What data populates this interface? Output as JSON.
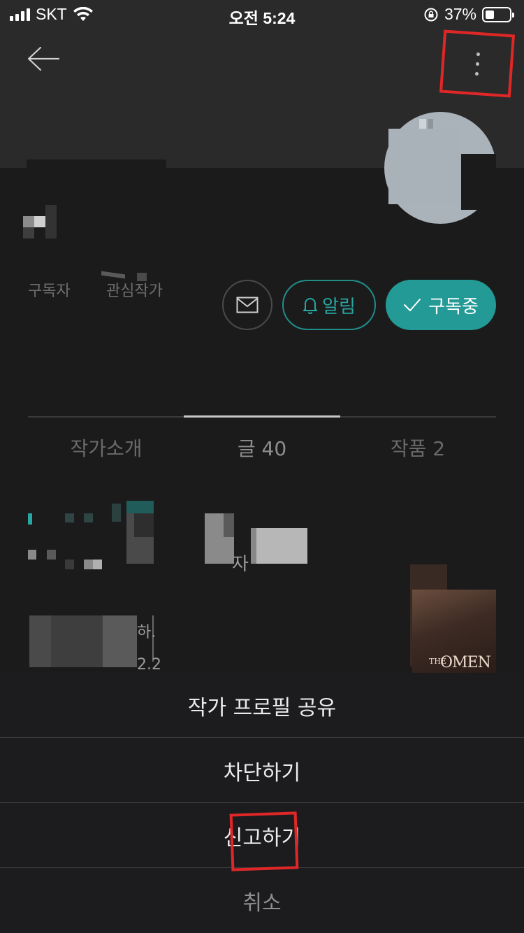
{
  "status_bar": {
    "carrier": "SKT",
    "time": "오전 5:24",
    "battery_percent": "37%",
    "battery_level": 0.37,
    "icons": [
      "signal-icon",
      "wifi-icon",
      "rotation-lock-icon",
      "battery-icon"
    ]
  },
  "header": {
    "back_icon": "arrow-left-icon",
    "more_icon": "more-vertical-icon"
  },
  "profile": {
    "subscriber_label": "구독자",
    "following_label": "관심작가"
  },
  "actions": {
    "mail_icon": "mail-icon",
    "alarm_label": "알림",
    "alarm_icon": "bell-icon",
    "subscribe_label": "구독중",
    "subscribe_icon": "check-icon"
  },
  "tabs": [
    {
      "label": "작가소개",
      "active": false
    },
    {
      "label": "글 40",
      "active": true
    },
    {
      "label": "작품 2",
      "active": false
    }
  ],
  "content": {
    "fragment_1": "자",
    "fragment_2": "하.",
    "fragment_3": "2.2",
    "book_title": "OMEN",
    "book_the": "THE"
  },
  "action_sheet": {
    "items": [
      {
        "label": "작가 프로필 공유"
      },
      {
        "label": "차단하기"
      },
      {
        "label": "신고하기"
      }
    ],
    "cancel_label": "취소"
  },
  "colors": {
    "accent": "#239a96",
    "accent_text": "#27a6a2",
    "background": "#1b1b1b",
    "header_bg": "#2a2a2a",
    "highlight": "#e02727"
  }
}
